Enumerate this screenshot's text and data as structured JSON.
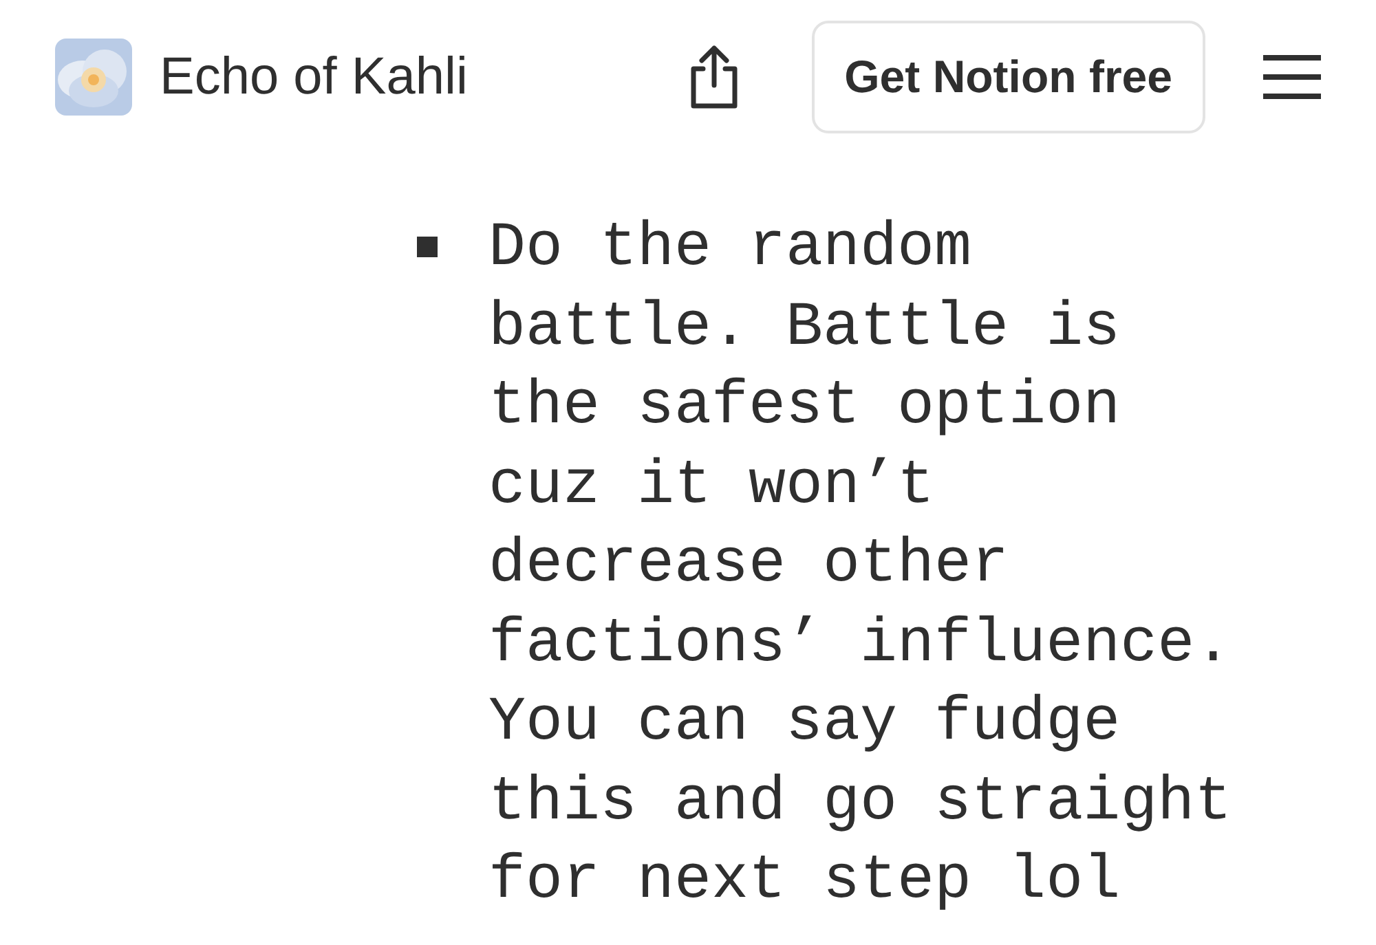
{
  "header": {
    "title": "Echo of Kahli",
    "button": "Get Notion free"
  },
  "list": [
    {
      "text": "Do the random battle. Battle is the safest option cuz it won’t decrease other factions’ influence. You can say fudge this and go straight for next step lol"
    }
  ]
}
